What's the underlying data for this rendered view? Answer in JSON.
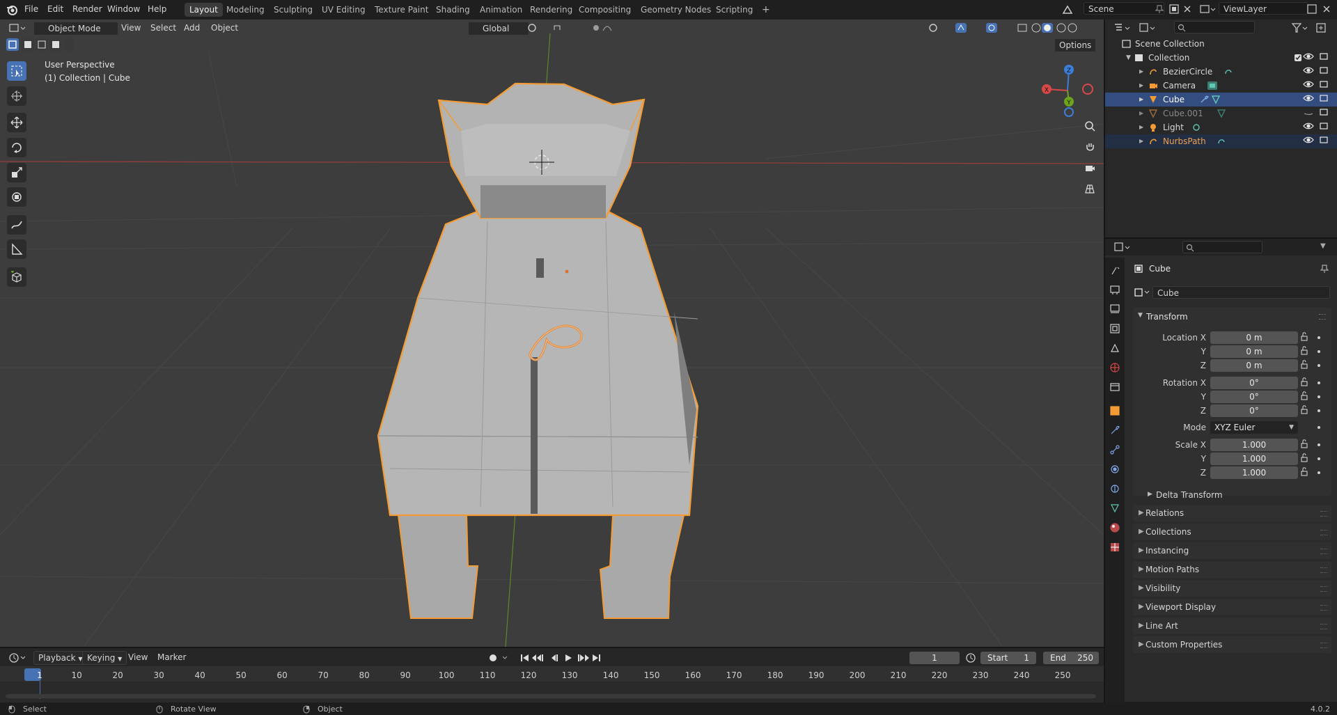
{
  "topbar": {
    "menus": [
      "File",
      "Edit",
      "Render",
      "Window",
      "Help"
    ],
    "workspaces": [
      "Layout",
      "Modeling",
      "Sculpting",
      "UV Editing",
      "Texture Paint",
      "Shading",
      "Animation",
      "Rendering",
      "Compositing",
      "Geometry Nodes",
      "Scripting"
    ],
    "active_workspace": "Layout",
    "add_tab": "+",
    "scene": "Scene",
    "view_layer": "ViewLayer"
  },
  "viewport_header": {
    "mode": "Object Mode",
    "menus": [
      "View",
      "Select",
      "Add",
      "Object"
    ],
    "transform_orientation": "Global",
    "options": "Options"
  },
  "viewport": {
    "perspective": "User Perspective",
    "collection_info": "(1) Collection | Cube",
    "axes": {
      "x": "X",
      "y": "Y",
      "z": "Z"
    }
  },
  "outliner": {
    "root": "Scene Collection",
    "collection": "Collection",
    "items": [
      {
        "name": "BezierCircle"
      },
      {
        "name": "Camera"
      },
      {
        "name": "Cube"
      },
      {
        "name": "Cube.001"
      },
      {
        "name": "Light"
      },
      {
        "name": "NurbsPath"
      }
    ]
  },
  "properties": {
    "object_name": "Cube",
    "datablock_name": "Cube",
    "transform_label": "Transform",
    "location": {
      "label": "Location X",
      "x": "0 m",
      "y": "0 m",
      "z": "0 m"
    },
    "rotation": {
      "label": "Rotation X",
      "x": "0°",
      "y": "0°",
      "z": "0°"
    },
    "mode_label": "Mode",
    "mode_value": "XYZ Euler",
    "scale": {
      "label": "Scale X",
      "x": "1.000",
      "y": "1.000",
      "z": "1.000"
    },
    "axis_y": "Y",
    "axis_z": "Z",
    "delta_transform": "Delta Transform",
    "sections": [
      "Relations",
      "Collections",
      "Instancing",
      "Motion Paths",
      "Visibility",
      "Viewport Display",
      "Line Art",
      "Custom Properties"
    ]
  },
  "timeline": {
    "menus": [
      "Playback",
      "Keying",
      "View",
      "Marker"
    ],
    "current_frame": "1",
    "start_label": "Start",
    "start_value": "1",
    "end_label": "End",
    "end_value": "250",
    "ticks": [
      "1",
      "10",
      "20",
      "30",
      "40",
      "50",
      "60",
      "70",
      "80",
      "90",
      "100",
      "110",
      "120",
      "130",
      "140",
      "150",
      "160",
      "170",
      "180",
      "190",
      "200",
      "210",
      "220",
      "230",
      "240",
      "250"
    ]
  },
  "statusbar": {
    "select": "Select",
    "rotate": "Rotate View",
    "object": "Object",
    "version": "4.0.2"
  },
  "colors": {
    "accent_blue": "#4772b3",
    "selection_orange": "#f39c35",
    "x_axis": "#d84848",
    "y_axis": "#6ea31e",
    "z_axis": "#3c7ed8"
  }
}
